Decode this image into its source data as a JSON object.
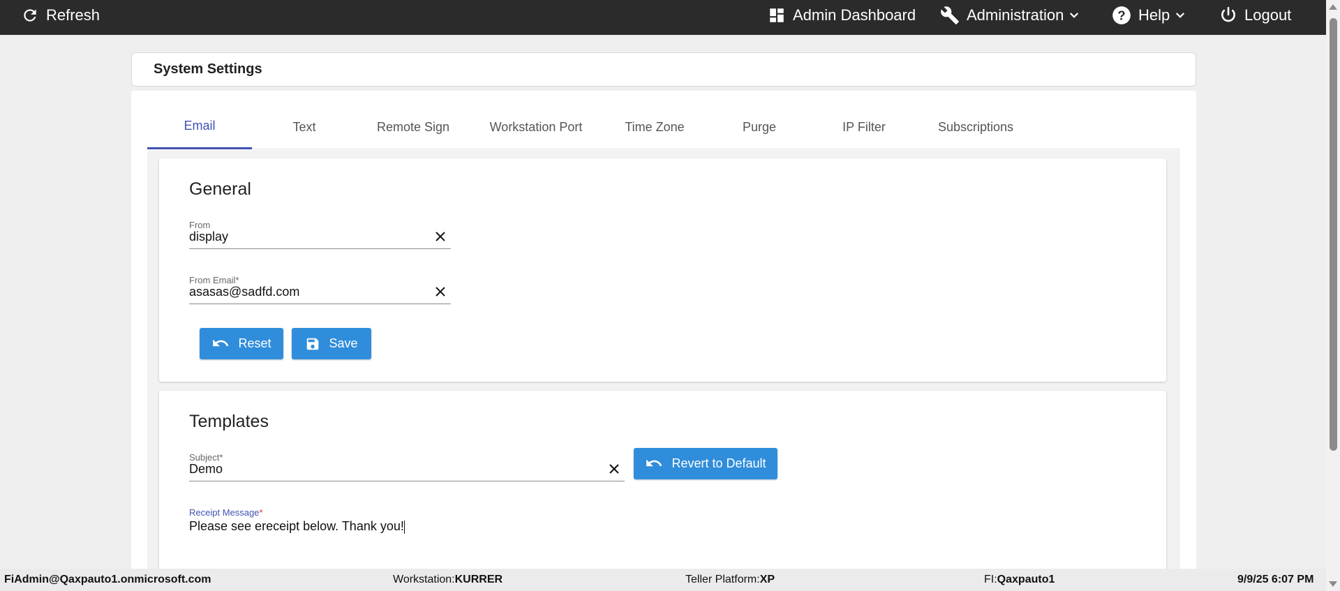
{
  "topbar": {
    "refresh": "Refresh",
    "admin_dashboard": "Admin Dashboard",
    "administration": "Administration",
    "help": "Help",
    "logout": "Logout"
  },
  "page": {
    "title": "System Settings"
  },
  "tabs": [
    "Email",
    "Text",
    "Remote Sign",
    "Workstation Port",
    "Time Zone",
    "Purge",
    "IP Filter",
    "Subscriptions"
  ],
  "active_tab": "Email",
  "general": {
    "title": "General",
    "from_label": "From",
    "from_value": "display",
    "from_email_label": "From Email*",
    "from_email_value": "asasas@sadfd.com",
    "reset_label": "Reset",
    "save_label": "Save"
  },
  "templates": {
    "title": "Templates",
    "subject_label": "Subject*",
    "subject_value": "Demo",
    "revert_label": "Revert to Default",
    "receipt_label": "Receipt Message",
    "receipt_required": "*",
    "receipt_value": "Please see ereceipt below. Thank you!"
  },
  "status": {
    "user": "FiAdmin@Qaxpauto1.onmicrosoft.com",
    "workstation_label": "Workstation: ",
    "workstation_value": "KURRER",
    "platform_label": "Teller Platform: ",
    "platform_value": "XP",
    "fi_label": "FI: ",
    "fi_value": "Qaxpauto1",
    "datetime": "9/9/25 6:07 PM"
  },
  "colors": {
    "topbar_bg": "#2b2b2b",
    "accent": "#3f51b5",
    "button": "#2f8ddb",
    "required": "#d32f2f"
  },
  "icons": {
    "refresh": "refresh-icon",
    "dashboard": "dashboard-icon",
    "administration": "wrench-icon",
    "help": "help-circle-icon",
    "logout": "power-icon",
    "clear": "close-icon",
    "reset": "undo-icon",
    "save": "floppy-disk-icon"
  }
}
